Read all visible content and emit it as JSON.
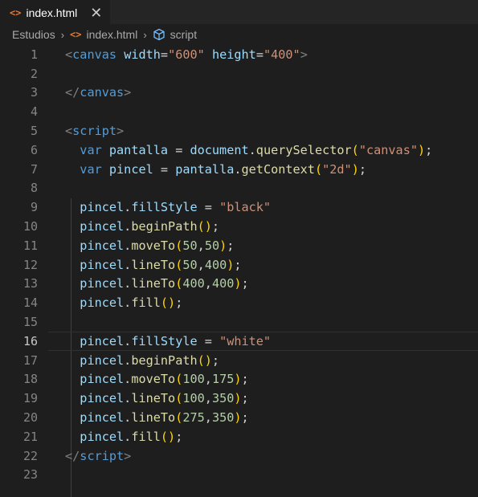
{
  "tab": {
    "filename": "index.html",
    "close": "✕",
    "file_icon": "<>"
  },
  "breadcrumb": {
    "folder": "Estudios",
    "file": "index.html",
    "symbol": "script",
    "sep": "›"
  },
  "editor": {
    "active_line": 16,
    "lines": [
      {
        "n": "1",
        "indent": "",
        "tokens": [
          [
            "tag",
            "<"
          ],
          [
            "tn",
            "canvas"
          ],
          [
            "pun",
            " "
          ],
          [
            "at",
            "width"
          ],
          [
            "pun",
            "="
          ],
          [
            "str",
            "\"600\""
          ],
          [
            "pun",
            " "
          ],
          [
            "at",
            "height"
          ],
          [
            "pun",
            "="
          ],
          [
            "str",
            "\"400\""
          ],
          [
            "tag",
            ">"
          ]
        ]
      },
      {
        "n": "2",
        "indent": "",
        "tokens": []
      },
      {
        "n": "3",
        "indent": "",
        "tokens": [
          [
            "tag",
            "</"
          ],
          [
            "tn",
            "canvas"
          ],
          [
            "tag",
            ">"
          ]
        ]
      },
      {
        "n": "4",
        "indent": "",
        "tokens": []
      },
      {
        "n": "5",
        "indent": "",
        "tokens": [
          [
            "tag",
            "<"
          ],
          [
            "tn",
            "script"
          ],
          [
            "tag",
            ">"
          ]
        ]
      },
      {
        "n": "6",
        "indent": "  ",
        "tokens": [
          [
            "kw",
            "var"
          ],
          [
            "pun",
            " "
          ],
          [
            "var",
            "pantalla"
          ],
          [
            "pun",
            " = "
          ],
          [
            "var",
            "document"
          ],
          [
            "pun",
            "."
          ],
          [
            "fn",
            "querySelector"
          ],
          [
            "br1",
            "("
          ],
          [
            "str",
            "\"canvas\""
          ],
          [
            "br1",
            ")"
          ],
          [
            "pun",
            ";"
          ]
        ]
      },
      {
        "n": "7",
        "indent": "  ",
        "tokens": [
          [
            "kw",
            "var"
          ],
          [
            "pun",
            " "
          ],
          [
            "var",
            "pincel"
          ],
          [
            "pun",
            " = "
          ],
          [
            "var",
            "pantalla"
          ],
          [
            "pun",
            "."
          ],
          [
            "fn",
            "getContext"
          ],
          [
            "br1",
            "("
          ],
          [
            "str",
            "\"2d\""
          ],
          [
            "br1",
            ")"
          ],
          [
            "pun",
            ";"
          ]
        ]
      },
      {
        "n": "8",
        "indent": "",
        "tokens": []
      },
      {
        "n": "9",
        "indent": "  ",
        "tokens": [
          [
            "var",
            "pincel"
          ],
          [
            "pun",
            "."
          ],
          [
            "var",
            "fillStyle"
          ],
          [
            "pun",
            " = "
          ],
          [
            "str",
            "\"black\""
          ]
        ]
      },
      {
        "n": "10",
        "indent": "  ",
        "tokens": [
          [
            "var",
            "pincel"
          ],
          [
            "pun",
            "."
          ],
          [
            "fn",
            "beginPath"
          ],
          [
            "br1",
            "()"
          ],
          [
            "pun",
            ";"
          ]
        ]
      },
      {
        "n": "11",
        "indent": "  ",
        "tokens": [
          [
            "var",
            "pincel"
          ],
          [
            "pun",
            "."
          ],
          [
            "fn",
            "moveTo"
          ],
          [
            "br1",
            "("
          ],
          [
            "num",
            "50"
          ],
          [
            "pun",
            ","
          ],
          [
            "num",
            "50"
          ],
          [
            "br1",
            ")"
          ],
          [
            "pun",
            ";"
          ]
        ]
      },
      {
        "n": "12",
        "indent": "  ",
        "tokens": [
          [
            "var",
            "pincel"
          ],
          [
            "pun",
            "."
          ],
          [
            "fn",
            "lineTo"
          ],
          [
            "br1",
            "("
          ],
          [
            "num",
            "50"
          ],
          [
            "pun",
            ","
          ],
          [
            "num",
            "400"
          ],
          [
            "br1",
            ")"
          ],
          [
            "pun",
            ";"
          ]
        ]
      },
      {
        "n": "13",
        "indent": "  ",
        "tokens": [
          [
            "var",
            "pincel"
          ],
          [
            "pun",
            "."
          ],
          [
            "fn",
            "lineTo"
          ],
          [
            "br1",
            "("
          ],
          [
            "num",
            "400"
          ],
          [
            "pun",
            ","
          ],
          [
            "num",
            "400"
          ],
          [
            "br1",
            ")"
          ],
          [
            "pun",
            ";"
          ]
        ]
      },
      {
        "n": "14",
        "indent": "  ",
        "tokens": [
          [
            "var",
            "pincel"
          ],
          [
            "pun",
            "."
          ],
          [
            "fn",
            "fill"
          ],
          [
            "br1",
            "()"
          ],
          [
            "pun",
            ";"
          ]
        ]
      },
      {
        "n": "15",
        "indent": "",
        "tokens": []
      },
      {
        "n": "16",
        "indent": "  ",
        "tokens": [
          [
            "var",
            "pincel"
          ],
          [
            "pun",
            "."
          ],
          [
            "var",
            "fillStyle"
          ],
          [
            "pun",
            " = "
          ],
          [
            "str",
            "\"white\""
          ]
        ]
      },
      {
        "n": "17",
        "indent": "  ",
        "tokens": [
          [
            "var",
            "pincel"
          ],
          [
            "pun",
            "."
          ],
          [
            "fn",
            "beginPath"
          ],
          [
            "br1",
            "()"
          ],
          [
            "pun",
            ";"
          ]
        ]
      },
      {
        "n": "18",
        "indent": "  ",
        "tokens": [
          [
            "var",
            "pincel"
          ],
          [
            "pun",
            "."
          ],
          [
            "fn",
            "moveTo"
          ],
          [
            "br1",
            "("
          ],
          [
            "num",
            "100"
          ],
          [
            "pun",
            ","
          ],
          [
            "num",
            "175"
          ],
          [
            "br1",
            ")"
          ],
          [
            "pun",
            ";"
          ]
        ]
      },
      {
        "n": "19",
        "indent": "  ",
        "tokens": [
          [
            "var",
            "pincel"
          ],
          [
            "pun",
            "."
          ],
          [
            "fn",
            "lineTo"
          ],
          [
            "br1",
            "("
          ],
          [
            "num",
            "100"
          ],
          [
            "pun",
            ","
          ],
          [
            "num",
            "350"
          ],
          [
            "br1",
            ")"
          ],
          [
            "pun",
            ";"
          ]
        ]
      },
      {
        "n": "20",
        "indent": "  ",
        "tokens": [
          [
            "var",
            "pincel"
          ],
          [
            "pun",
            "."
          ],
          [
            "fn",
            "lineTo"
          ],
          [
            "br1",
            "("
          ],
          [
            "num",
            "275"
          ],
          [
            "pun",
            ","
          ],
          [
            "num",
            "350"
          ],
          [
            "br1",
            ")"
          ],
          [
            "pun",
            ";"
          ]
        ]
      },
      {
        "n": "21",
        "indent": "  ",
        "tokens": [
          [
            "var",
            "pincel"
          ],
          [
            "pun",
            "."
          ],
          [
            "fn",
            "fill"
          ],
          [
            "br1",
            "()"
          ],
          [
            "pun",
            ";"
          ]
        ]
      },
      {
        "n": "22",
        "indent": "",
        "tokens": [
          [
            "tag",
            "</"
          ],
          [
            "tn",
            "script"
          ],
          [
            "tag",
            ">"
          ]
        ]
      },
      {
        "n": "23",
        "indent": "",
        "tokens": []
      }
    ]
  },
  "colors": {
    "background": "#1e1e1e",
    "tabbar": "#252526",
    "file_icon": "#e37933",
    "keyword": "#569cd6",
    "variable": "#9cdcfe",
    "function": "#dcdcaa",
    "string": "#ce9178",
    "number": "#b5cea8",
    "bracket": "#ffd700"
  }
}
